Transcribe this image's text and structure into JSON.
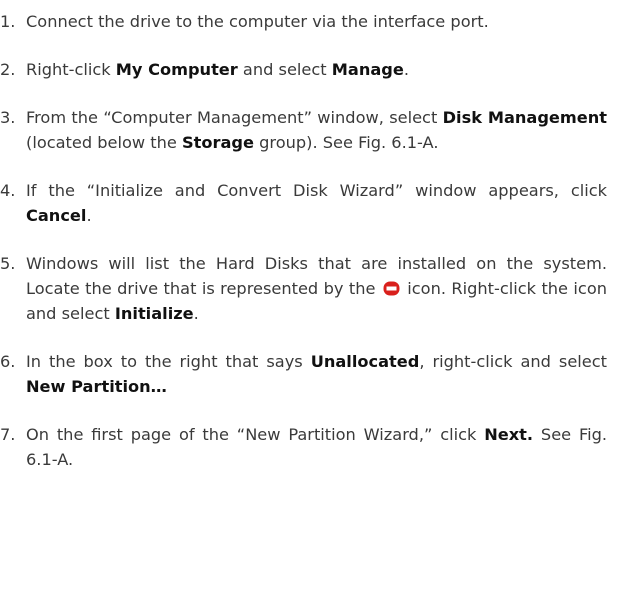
{
  "icons": {
    "uninitialized_disk": {
      "name": "disk-not-initialized-icon",
      "color": "#d9201c"
    }
  },
  "steps": [
    {
      "num": "1.",
      "parts": [
        "Connect the drive to the computer via the interface port."
      ]
    },
    {
      "num": "2.",
      "parts": [
        "Right-click ",
        "My Computer",
        " and select ",
        "Manage",
        "."
      ]
    },
    {
      "num": "3.",
      "parts": [
        "From the “Computer Management” window, select ",
        "Disk Management",
        " (located below the ",
        "Storage",
        " group). See Fig. 6.1-A."
      ]
    },
    {
      "num": "4.",
      "parts": [
        "If the “Initialize and Convert Disk Wizard” window appears, click ",
        "Cancel",
        "."
      ]
    },
    {
      "num": "5.",
      "parts": [
        "Windows will list the Hard Disks that are installed on the system. Locate the drive that is represented by the ",
        " icon. Right-click the icon and select ",
        "Initialize",
        "."
      ]
    },
    {
      "num": "6.",
      "parts": [
        "In the box to the right that says ",
        "Unallocated",
        ", right-click and select ",
        "New Partition…"
      ]
    },
    {
      "num": "7.",
      "parts": [
        "On the first page of the “New Partition Wizard,” click ",
        "Next.",
        " See Fig. 6.1-A."
      ]
    }
  ]
}
